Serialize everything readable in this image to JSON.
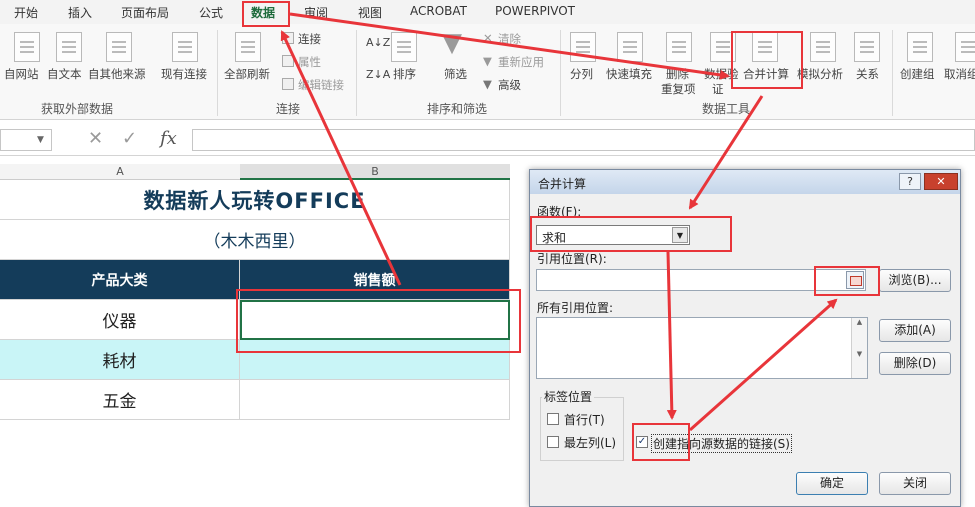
{
  "ribbon": {
    "tabs": [
      {
        "label": "开始",
        "active": false
      },
      {
        "label": "插入",
        "active": false
      },
      {
        "label": "页面布局",
        "active": false
      },
      {
        "label": "公式",
        "active": false
      },
      {
        "label": "数据",
        "active": true
      },
      {
        "label": "审阅",
        "active": false
      },
      {
        "label": "视图",
        "active": false
      },
      {
        "label": "ACROBAT",
        "active": false
      },
      {
        "label": "POWERPIVOT",
        "active": false
      }
    ],
    "get_external": {
      "label": "获取外部数据",
      "buttons": [
        "自网站",
        "自文本",
        "自其他来源",
        "现有连接"
      ]
    },
    "connections": {
      "label": "连接",
      "refresh_all": "全部刷新",
      "connect": "连接",
      "properties": "属性",
      "edit_links": "编辑链接"
    },
    "sort_filter": {
      "label": "排序和筛选",
      "sort": "排序",
      "filter": "筛选",
      "clear": "清除",
      "reapply": "重新应用",
      "advanced": "高级"
    },
    "data_tools": {
      "label": "数据工具",
      "text_to_columns": "分列",
      "flash_fill": "快速填充",
      "remove_duplicates_1": "删除",
      "remove_duplicates_2": "重复项",
      "validation_1": "数据验",
      "validation_2": "证",
      "consolidate": "合并计算",
      "what_if": "模拟分析",
      "relationships": "关系"
    },
    "outline": {
      "group": "创建组",
      "ungroup": "取消组"
    }
  },
  "formula_bar": {
    "fx": "fx",
    "cancel": "✕",
    "enter": "✓"
  },
  "sheet": {
    "col_a": "A",
    "col_b": "B",
    "title": "数据新人玩转OFFICE",
    "subtitle": "（木木西里）",
    "header_category": "产品大类",
    "header_sales": "销售额",
    "rows": [
      "仪器",
      "耗材",
      "五金"
    ]
  },
  "dialog": {
    "title": "合并计算",
    "help": "?",
    "close": "✕",
    "function_label": "函数(F):",
    "function_value": "求和",
    "reference_label": "引用位置(R):",
    "browse": "浏览(B)...",
    "all_references_label": "所有引用位置:",
    "add": "添加(A)",
    "delete": "删除(D)",
    "label_position": "标签位置",
    "top_row": "首行(T)",
    "left_column": "最左列(L)",
    "create_links": "创建指向源数据的链接(S)",
    "ok": "确定",
    "cancel": "关闭"
  },
  "colors": {
    "header_fill": "#143c5a",
    "row_highlight": "#c9f5f7",
    "annotation": "#e8353a",
    "active_tab": "#1e6b3c"
  }
}
